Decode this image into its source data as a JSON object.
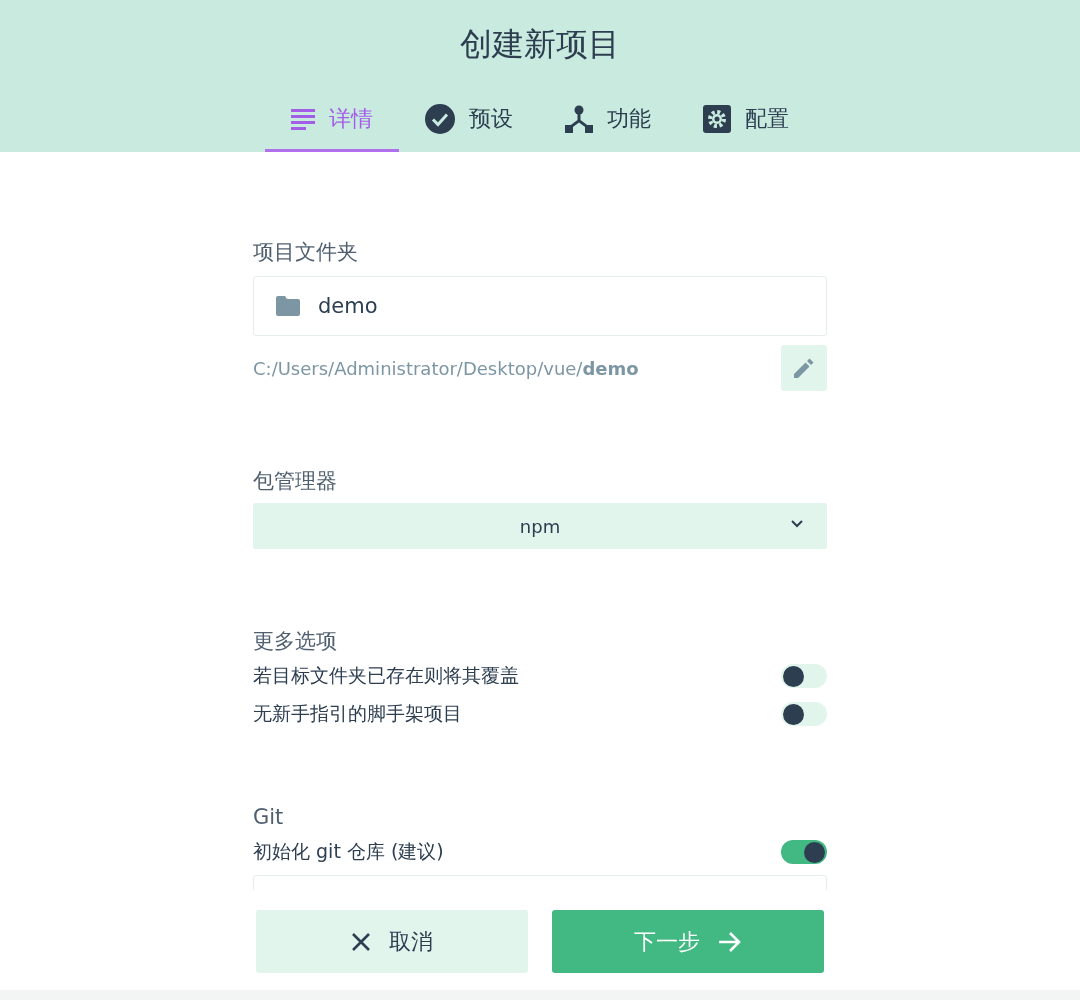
{
  "title": "创建新项目",
  "tabs": [
    {
      "label": "详情",
      "kind": "list",
      "selected": true
    },
    {
      "label": "预设",
      "kind": "check",
      "selected": false
    },
    {
      "label": "功能",
      "kind": "fork",
      "selected": false
    },
    {
      "label": "配置",
      "kind": "gear",
      "selected": false
    }
  ],
  "folder": {
    "label": "项目文件夹",
    "value": "demo",
    "path": "C:/Users/Administrator/Desktop/vue/**demo**"
  },
  "package_manager": {
    "label": "包管理器",
    "value": "npm"
  },
  "more_options": {
    "label": "更多选项",
    "options": [
      {
        "label": "若目标文件夹已存在则将其覆盖",
        "on": false
      },
      {
        "label": "无新手指引的脚手架项目",
        "on": false
      }
    ]
  },
  "git": {
    "label": "Git",
    "options": [
      {
        "label": "初始化 git 仓库 (建议)",
        "on": true
      }
    ]
  },
  "buttons": [
    {
      "label": "取消",
      "kind": "cancel"
    },
    {
      "label": "下一步",
      "kind": "next"
    }
  ]
}
